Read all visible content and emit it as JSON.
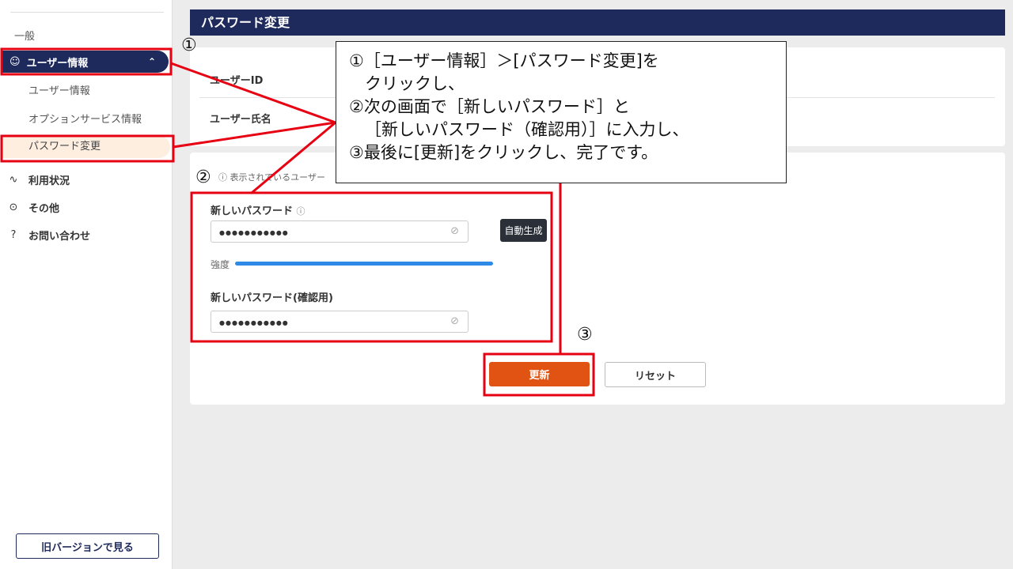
{
  "sidebar": {
    "section": "一般",
    "parent": "ユーザー情報",
    "items": [
      "ユーザー情報",
      "オプションサービス情報",
      "パスワード変更"
    ],
    "nav": [
      {
        "label": "利用状況",
        "icon": "activity-icon"
      },
      {
        "label": "その他",
        "icon": "more-icon"
      },
      {
        "label": "お問い合わせ",
        "icon": "chat-help-icon"
      }
    ],
    "old_version": "旧バージョンで見る"
  },
  "header": {
    "title": "パスワード変更"
  },
  "user": {
    "id_label": "ユーザーID",
    "name_label": "ユーザー氏名"
  },
  "form": {
    "notice": "表示されているユーザー",
    "new_label": "新しいパスワード",
    "new_value": "●●●●●●●●●●●",
    "generate": "自動生成",
    "strength_label": "強度",
    "strength": 1.0,
    "confirm_label": "新しいパスワード(確認用)",
    "confirm_value": "●●●●●●●●●●●",
    "update": "更新",
    "reset": "リセット"
  },
  "annotation": {
    "text": "①［ユーザー情報］＞[パスワード変更]を\n   クリックし、\n②次の画面で［新しいパスワード］と\n   ［新しいパスワード（確認用）］に入力し、\n③最後に[更新]をクリックし、完了です。",
    "n1": "①",
    "n2": "②",
    "n3": "③",
    "color": "#e60012"
  }
}
